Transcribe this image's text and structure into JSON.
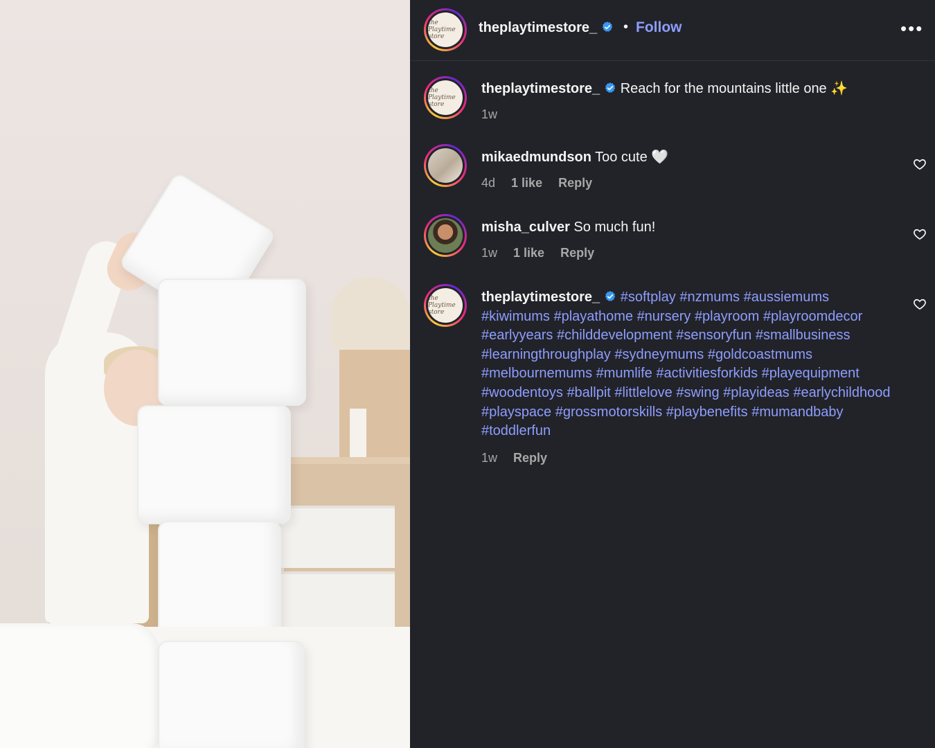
{
  "header": {
    "username": "theplaytimestore_",
    "follow_label": "Follow",
    "separator": "•",
    "more_icon": "more-horizontal-icon",
    "avatar_text": "the Playtime store"
  },
  "caption": {
    "username": "theplaytimestore_",
    "text": "Reach for the mountains little one ✨",
    "time": "1w"
  },
  "comments": [
    {
      "username": "mikaedmundson",
      "text": "Too cute 🤍",
      "time": "4d",
      "likes": "1 like",
      "reply_label": "Reply"
    },
    {
      "username": "misha_culver",
      "text": "So much fun!",
      "time": "1w",
      "likes": "1 like",
      "reply_label": "Reply"
    }
  ],
  "hashtag_comment": {
    "username": "theplaytimestore_",
    "hashtags": [
      "#softplay",
      "#nzmums",
      "#aussiemums",
      "#kiwimums",
      "#playathome",
      "#nursery",
      "#playroom",
      "#playroomdecor",
      "#earlyyears",
      "#childdevelopment",
      "#sensoryfun",
      "#smallbusiness",
      "#learningthroughplay",
      "#sydneymums",
      "#goldcoastmums",
      "#melbournemums",
      "#mumlife",
      "#activitiesforkids",
      "#playequipment",
      "#woodentoys",
      "#ballpit",
      "#littlelove",
      "#swing",
      "#playideas",
      "#earlychildhood",
      "#playspace",
      "#grossmotorskills",
      "#playbenefits",
      "#mumandbaby",
      "#toddlerfun"
    ],
    "time": "1w",
    "reply_label": "Reply"
  },
  "colors": {
    "background": "#212328",
    "link": "#8e9dff",
    "verified": "#3897f0",
    "muted": "#a8a8a8"
  }
}
